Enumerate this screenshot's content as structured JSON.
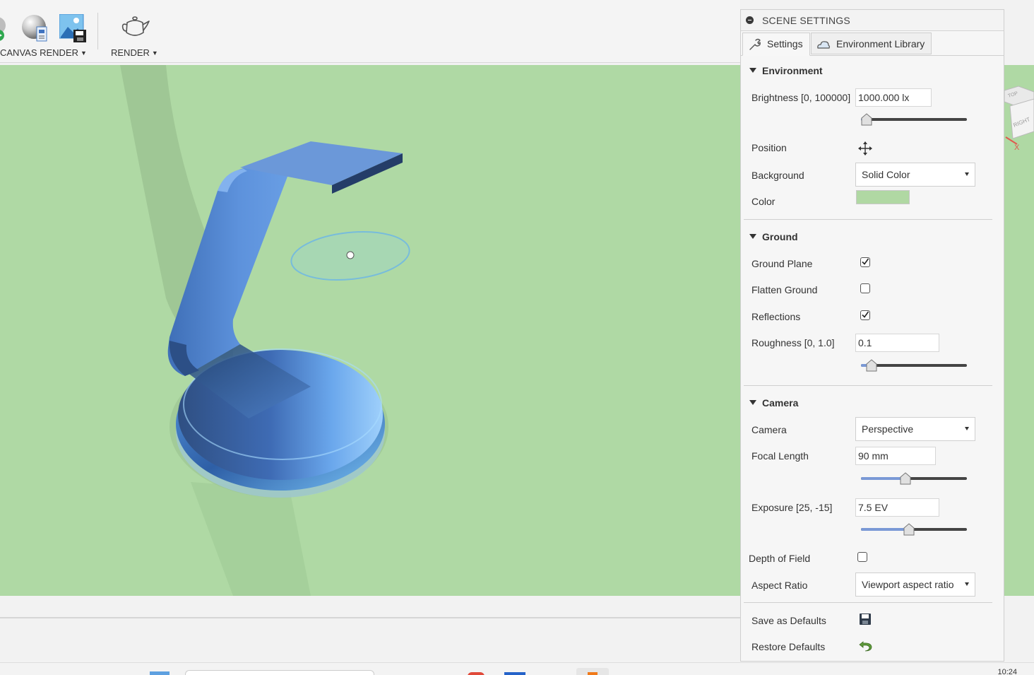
{
  "toolbar": {
    "canvas_render_label": "CANVAS RENDER",
    "render_label": "RENDER"
  },
  "panel": {
    "title": "SCENE SETTINGS",
    "tabs": [
      {
        "label": "Settings",
        "icon": "wrench-icon",
        "active": true
      },
      {
        "label": "Environment Library",
        "icon": "cloud-environment-icon",
        "active": false
      }
    ],
    "environment": {
      "heading": "Environment",
      "brightness_label": "Brightness [0, 100000]",
      "brightness_value": "1000.000 lx",
      "brightness_slider": 0.01,
      "position_label": "Position",
      "position_icon": "move-arrows-icon",
      "background_label": "Background",
      "background_value": "Solid Color",
      "color_label": "Color",
      "color_value": "#b0d8a3"
    },
    "ground": {
      "heading": "Ground",
      "ground_plane_label": "Ground Plane",
      "ground_plane_checked": true,
      "flatten_ground_label": "Flatten Ground",
      "flatten_ground_checked": false,
      "reflections_label": "Reflections",
      "reflections_checked": true,
      "roughness_label": "Roughness [0, 1.0]",
      "roughness_value": "0.1",
      "roughness_slider": 0.1
    },
    "camera": {
      "heading": "Camera",
      "camera_label": "Camera",
      "camera_value": "Perspective",
      "focal_length_label": "Focal Length",
      "focal_length_value": "90 mm",
      "focal_length_slider": 0.42,
      "exposure_label": "Exposure [25, -15]",
      "exposure_value": "7.5 EV",
      "exposure_slider": 0.45,
      "depth_of_field_label": "Depth of Field",
      "depth_of_field_checked": false,
      "aspect_ratio_label": "Aspect Ratio",
      "aspect_ratio_value": "Viewport aspect ratio"
    },
    "footer": {
      "save_defaults_label": "Save as Defaults",
      "restore_defaults_label": "Restore Defaults"
    }
  },
  "viewcube": {
    "top_label": "TOP",
    "right_label": "RIGHT",
    "axis_label": "X"
  },
  "taskbar": {
    "clock": "10:24"
  },
  "colors": {
    "viewport_background": "#afd9a4",
    "model_blue": "#5b8fd8",
    "accent": "#7a99d6"
  }
}
